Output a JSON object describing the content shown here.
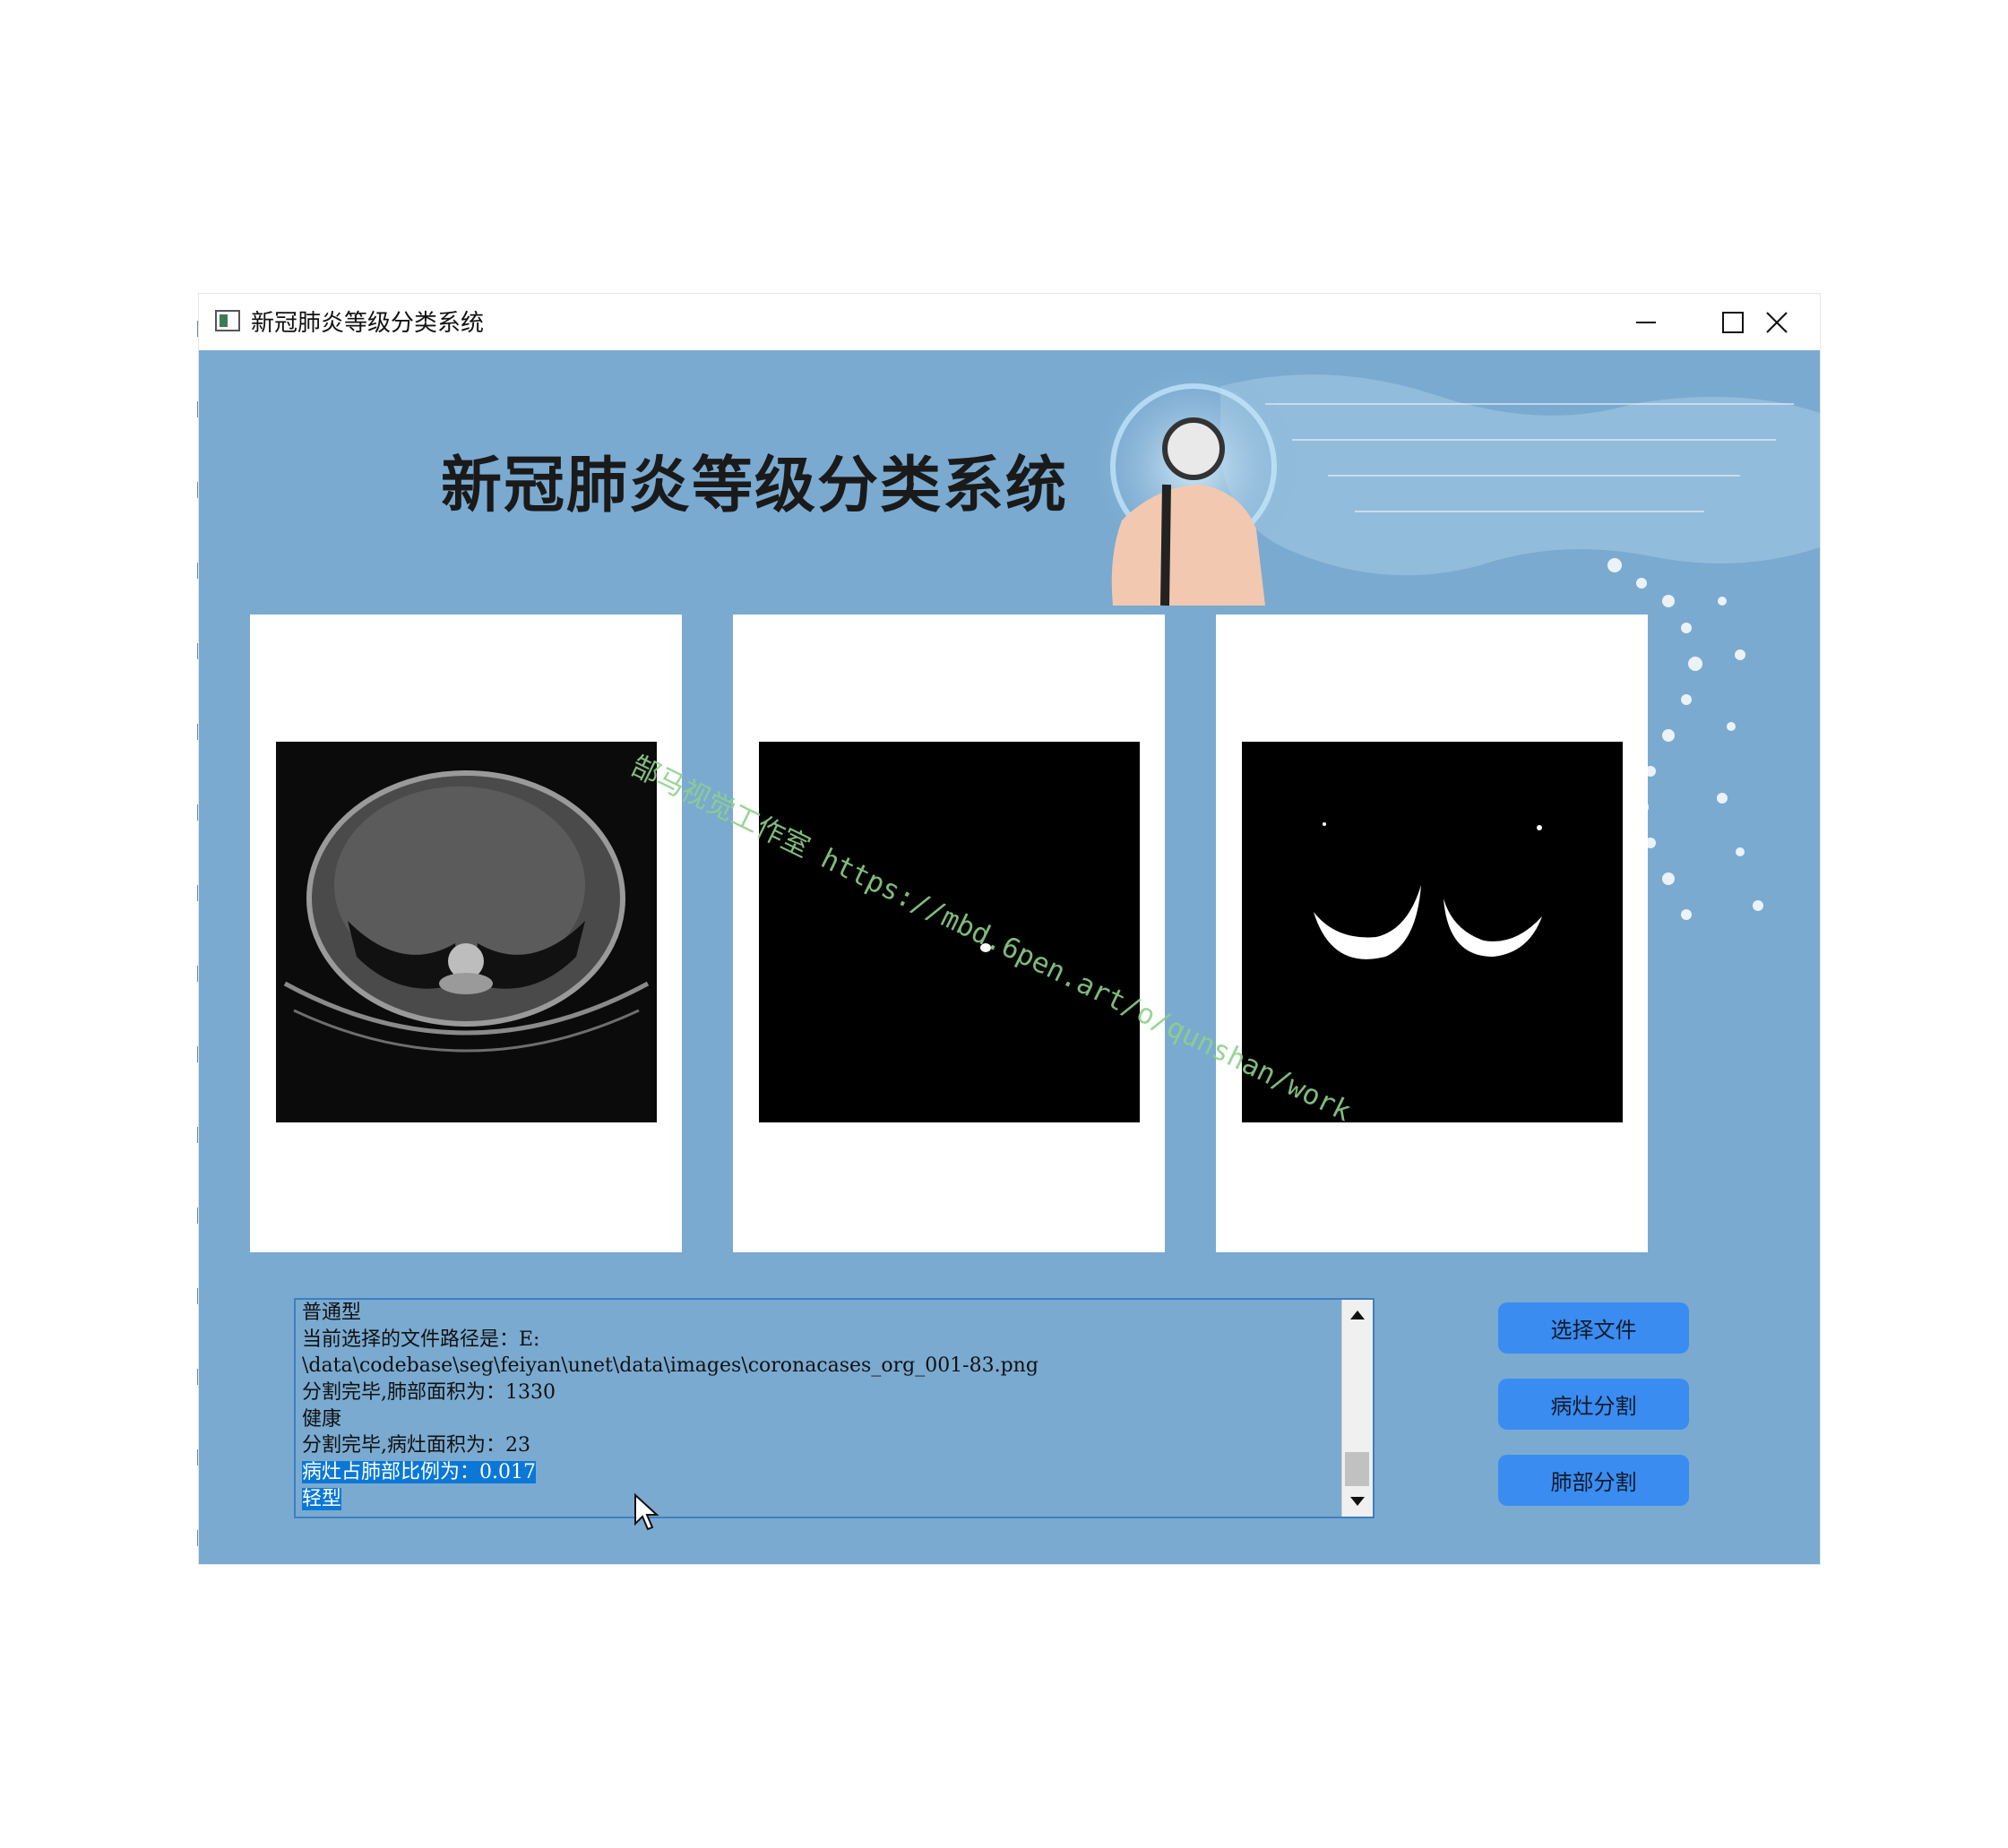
{
  "window": {
    "title": "新冠肺炎等级分类系统",
    "controls": [
      "minimize",
      "maximize",
      "close"
    ]
  },
  "banner": {
    "title": "新冠肺炎等级分类系统"
  },
  "panels": [
    {
      "name": "ct-original",
      "content": "CT scan slice"
    },
    {
      "name": "lesion-mask",
      "content": "lesion segmentation mask"
    },
    {
      "name": "lung-mask",
      "content": "lung segmentation mask"
    }
  ],
  "log": {
    "lines": [
      "普通型",
      "当前选择的文件路径是：E:",
      "\\data\\codebase\\seg\\feiyan\\unet\\data\\images\\coronacases_org_001-83.png",
      "分割完毕,肺部面积为：1330",
      "健康",
      "分割完毕,病灶面积为：23",
      "病灶占肺部比例为：0.017",
      "轻型"
    ],
    "selected_from_line": 6
  },
  "buttons": {
    "select_file": "选择文件",
    "lesion_seg": "病灶分割",
    "lung_seg": "肺部分割"
  },
  "watermark": "郜马视觉工作室 https://mbd.6pen.art/o/qunshan/work",
  "colors": {
    "client_bg": "#7aaad0",
    "button_bg": "#3a8cf0",
    "selection": "#0b78d7"
  }
}
